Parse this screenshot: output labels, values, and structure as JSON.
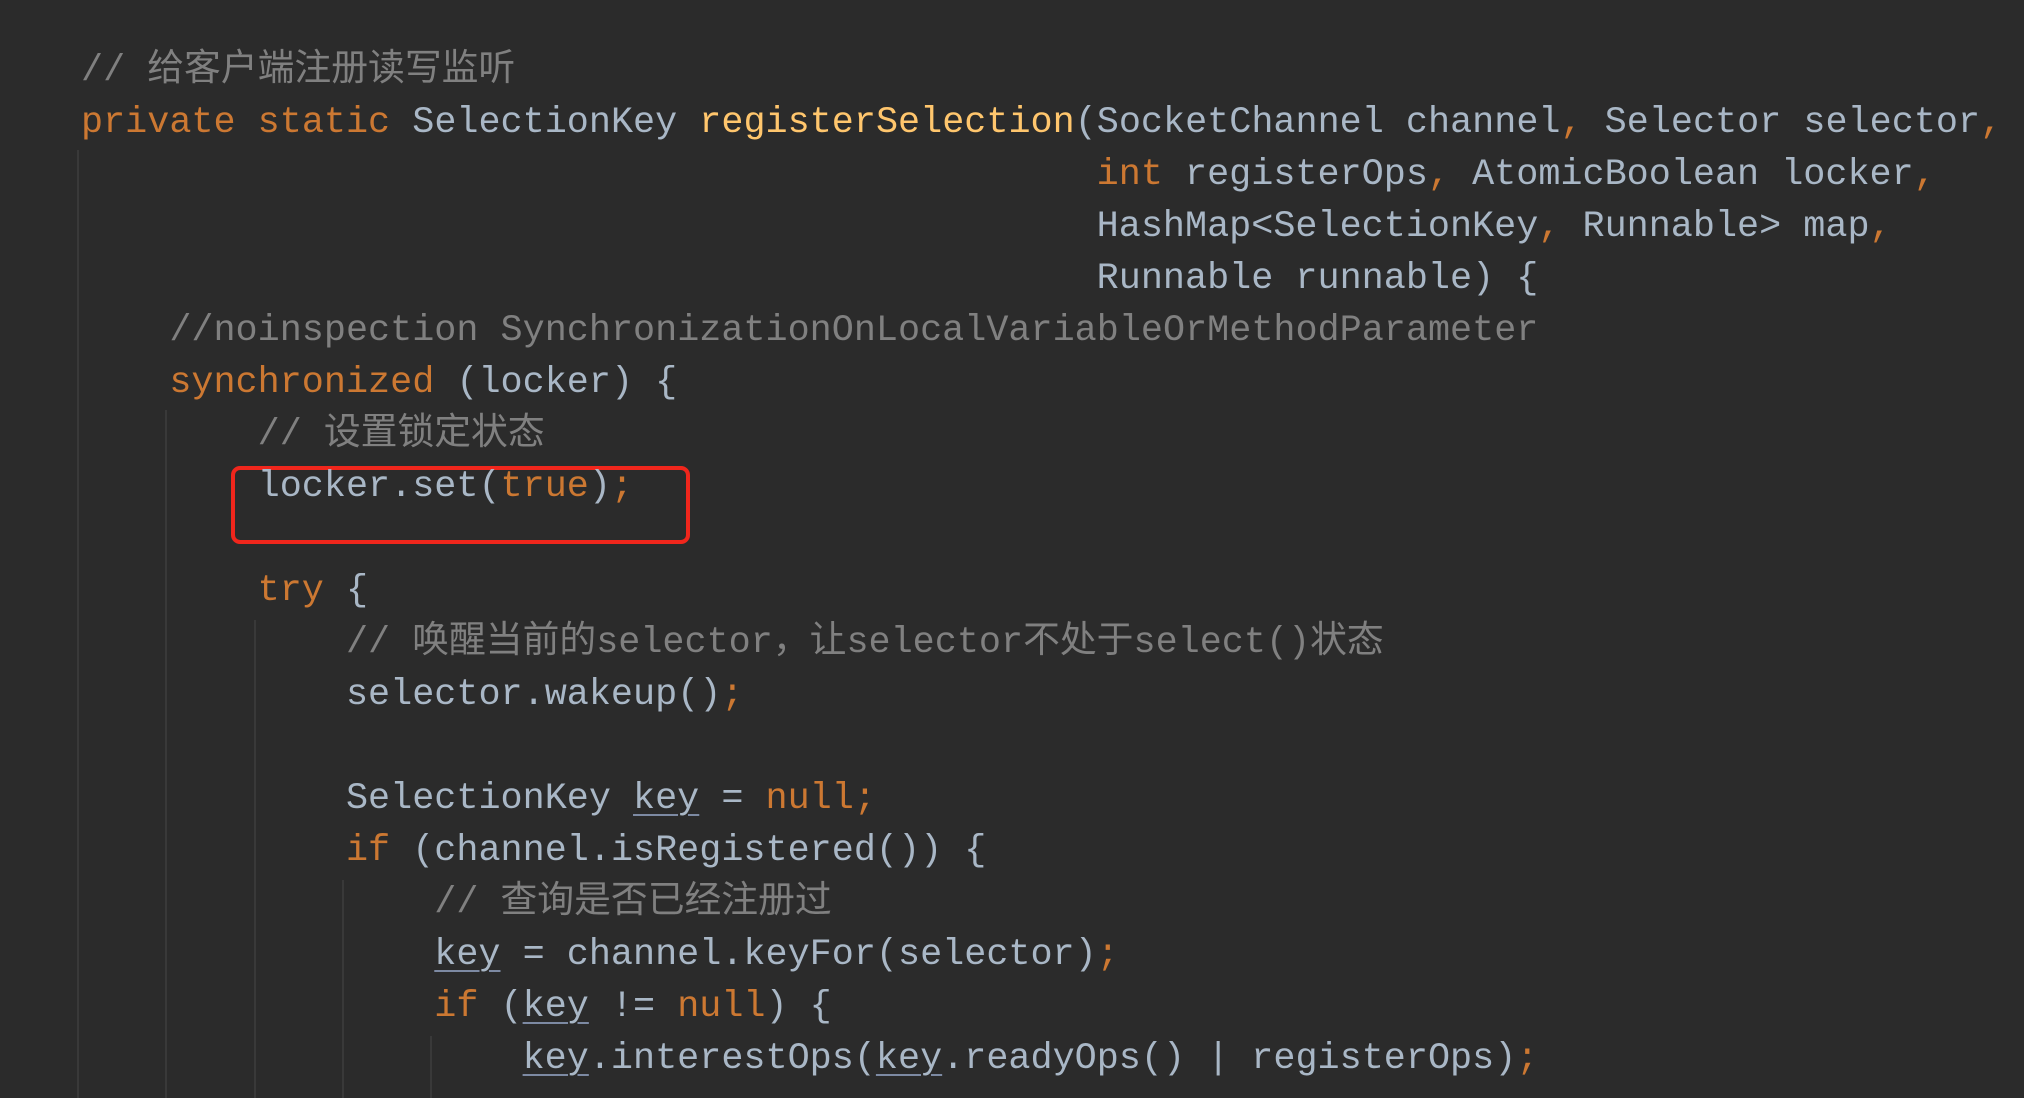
{
  "editor": {
    "theme_colors": {
      "background": "#2b2b2b",
      "text": "#a9b7c6",
      "keyword": "#cc7832",
      "method": "#ffc66d",
      "comment": "#808080",
      "highlight_box": "#f0261c"
    },
    "lines": [
      {
        "tokens": [
          {
            "t": "// ",
            "c": "cm"
          },
          {
            "t": "给客户端注册读写监听",
            "c": "cm cjk"
          }
        ]
      },
      {
        "tokens": [
          {
            "t": "private static ",
            "c": "kw"
          },
          {
            "t": "SelectionKey ",
            "c": ""
          },
          {
            "t": "registerSelection",
            "c": "fn"
          },
          {
            "t": "(SocketChannel channel",
            "c": ""
          },
          {
            "t": ", ",
            "c": "kw"
          },
          {
            "t": "Selector selector",
            "c": ""
          },
          {
            "t": ",",
            "c": "kw"
          }
        ]
      },
      {
        "tokens": [
          {
            "t": "int ",
            "c": "kw"
          },
          {
            "t": "registerOps",
            "c": ""
          },
          {
            "t": ", ",
            "c": "kw"
          },
          {
            "t": "AtomicBoolean locker",
            "c": ""
          },
          {
            "t": ",",
            "c": "kw"
          }
        ]
      },
      {
        "tokens": [
          {
            "t": "HashMap<SelectionKey",
            "c": ""
          },
          {
            "t": ", ",
            "c": "kw"
          },
          {
            "t": "Runnable> map",
            "c": ""
          },
          {
            "t": ",",
            "c": "kw"
          }
        ]
      },
      {
        "tokens": [
          {
            "t": "Runnable runnable) {",
            "c": ""
          }
        ]
      },
      {
        "tokens": [
          {
            "t": "//noinspection SynchronizationOnLocalVariableOrMethodParameter",
            "c": "cm"
          }
        ]
      },
      {
        "tokens": [
          {
            "t": "synchronized ",
            "c": "kw"
          },
          {
            "t": "(locker) {",
            "c": ""
          }
        ]
      },
      {
        "tokens": [
          {
            "t": "// ",
            "c": "cm"
          },
          {
            "t": "设置锁定状态",
            "c": "cm cjk"
          }
        ]
      },
      {
        "tokens": [
          {
            "t": "locker.set(",
            "c": ""
          },
          {
            "t": "true",
            "c": "kw"
          },
          {
            "t": ")",
            "c": ""
          },
          {
            "t": ";",
            "c": "kw"
          }
        ]
      },
      {
        "tokens": [
          {
            "t": "try ",
            "c": "kw"
          },
          {
            "t": "{",
            "c": ""
          }
        ]
      },
      {
        "tokens": [
          {
            "t": "// ",
            "c": "cm"
          },
          {
            "t": "唤醒当前的",
            "c": "cm cjk"
          },
          {
            "t": "selector",
            "c": "cm"
          },
          {
            "t": "，让",
            "c": "cm cjk"
          },
          {
            "t": "selector",
            "c": "cm"
          },
          {
            "t": "不处于",
            "c": "cm cjk"
          },
          {
            "t": "select()",
            "c": "cm"
          },
          {
            "t": "状态",
            "c": "cm cjk"
          }
        ]
      },
      {
        "tokens": [
          {
            "t": "selector.wakeup()",
            "c": ""
          },
          {
            "t": ";",
            "c": "kw"
          }
        ]
      },
      {
        "tokens": [
          {
            "t": "SelectionKey ",
            "c": ""
          },
          {
            "t": "key",
            "c": "ul"
          },
          {
            "t": " = ",
            "c": ""
          },
          {
            "t": "null;",
            "c": "kw"
          }
        ]
      },
      {
        "tokens": [
          {
            "t": "if ",
            "c": "kw"
          },
          {
            "t": "(channel.isRegistered()) {",
            "c": ""
          }
        ]
      },
      {
        "tokens": [
          {
            "t": "// ",
            "c": "cm"
          },
          {
            "t": "查询是否已经注册过",
            "c": "cm cjk"
          }
        ]
      },
      {
        "tokens": [
          {
            "t": "key",
            "c": "ul"
          },
          {
            "t": " = channel.keyFor(selector)",
            "c": ""
          },
          {
            "t": ";",
            "c": "kw"
          }
        ]
      },
      {
        "tokens": [
          {
            "t": "if ",
            "c": "kw"
          },
          {
            "t": "(",
            "c": ""
          },
          {
            "t": "key",
            "c": "ul"
          },
          {
            "t": " != ",
            "c": ""
          },
          {
            "t": "null",
            "c": "kw"
          },
          {
            "t": ") {",
            "c": ""
          }
        ]
      },
      {
        "tokens": [
          {
            "t": "key",
            "c": "ul"
          },
          {
            "t": ".interestOps(",
            "c": ""
          },
          {
            "t": "key",
            "c": "ul"
          },
          {
            "t": ".readyOps() | registerOps)",
            "c": ""
          },
          {
            "t": ";",
            "c": "kw"
          }
        ]
      }
    ]
  }
}
